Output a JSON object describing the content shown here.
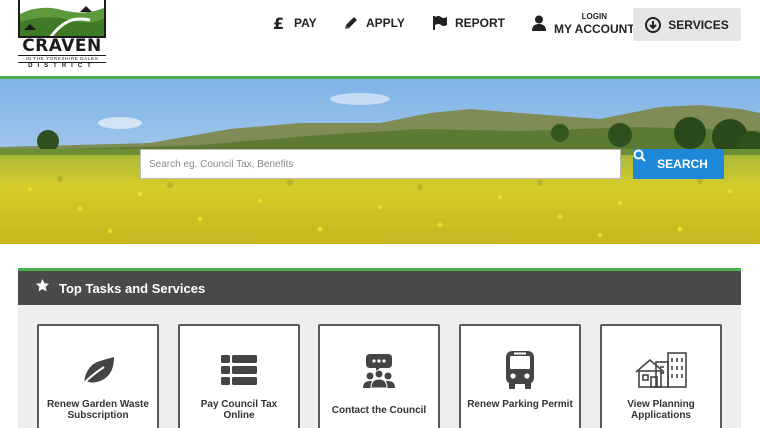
{
  "logo": {
    "name": "CRAVEN",
    "tagline": "IN THE YORKSHIRE DALES",
    "district": "DISTRICT"
  },
  "nav": {
    "pay": {
      "label": "PAY",
      "icon": "pound-icon"
    },
    "apply": {
      "label": "APPLY",
      "icon": "pencil-icon"
    },
    "report": {
      "label": "REPORT",
      "icon": "flag-icon"
    },
    "account": {
      "login": "LOGIN",
      "label": "MY ACCOUNT",
      "icon": "user-icon"
    },
    "services": {
      "label": "SERVICES",
      "icon": "circle-arrow-down-icon"
    }
  },
  "search": {
    "placeholder": "Search eg. Council Tax, Benefits",
    "value": "",
    "button_label": "SEARCH",
    "icon": "search-icon"
  },
  "top_tasks": {
    "title": "Top Tasks and Services",
    "icon": "star-icon",
    "cards": [
      {
        "label": "Renew Garden Waste Subscription",
        "icon": "leaf-icon"
      },
      {
        "label": "Pay Council Tax Online",
        "icon": "list-icon"
      },
      {
        "label": "Contact the Council",
        "icon": "people-chat-icon"
      },
      {
        "label": "Renew Parking Permit",
        "icon": "bus-icon"
      },
      {
        "label": "View Planning Applications",
        "icon": "buildings-icon"
      }
    ]
  },
  "colors": {
    "accent_green": "#4caf50",
    "search_blue": "#1e88d8",
    "panel_header": "#4a4a4a",
    "panel_bg": "#eeeeee"
  }
}
